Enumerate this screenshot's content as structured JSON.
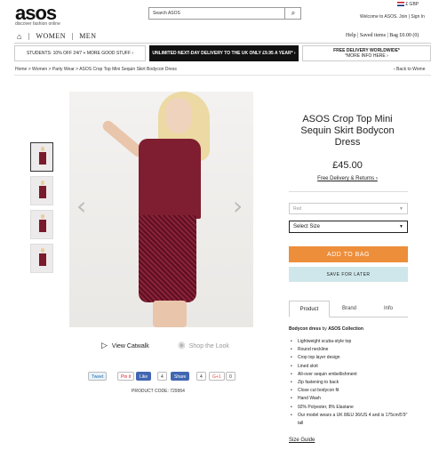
{
  "header": {
    "logo": "asos",
    "tagline": "discover fashion online",
    "search_placeholder": "Search ASOS",
    "currency": "£ GBP",
    "welcome": "Welcome to ASOS.  Join | Sign In",
    "nav": [
      "WOMEN",
      "MEN"
    ],
    "util_links": [
      "Help",
      "Saved items",
      "Bag £0.00 (0)"
    ]
  },
  "banners": {
    "students": "STUDENTS: 10% OFF 24/7 + MORE GOOD STUFF ›",
    "next_day": "UNLIMITED NEXT-DAY DELIVERY TO THE UK ONLY £9.95 A YEAR* ›",
    "free_delivery_title": "FREE DELIVERY WORLDWIDE*",
    "free_delivery_sub": "*MORE INFO HERE ›"
  },
  "breadcrumb": {
    "text": "Home  >  Women  >  Party Wear  >  ASOS Crop Top Mini Sequin Skirt Bodycon Dress",
    "back": "‹ Back to Wome"
  },
  "media": {
    "catwalk": "View Catwalk",
    "shop_look": "Shop the Look",
    "social": {
      "tweet": "Tweet",
      "pin": "Pin it",
      "like": "Like",
      "like_count": "4",
      "share": "Share",
      "share_count": "4",
      "gplus": "G+1",
      "gplus_count": "0"
    },
    "product_code": "PRODUCT CODE: 729954"
  },
  "product": {
    "title": "ASOS Crop Top Mini Sequin Skirt Bodycon Dress",
    "price": "£45.00",
    "delivery": "Free Delivery & Returns ›",
    "colour": "Red",
    "size": "Select Size",
    "add_to_bag": "ADD TO BAG",
    "save_later": "SAVE FOR LATER",
    "tabs": [
      "Product",
      "Brand",
      "Info"
    ],
    "desc_lead": "Bodycon dress",
    "desc_by": " by ",
    "desc_brand": "ASOS Collection",
    "bullets": [
      "Lightweight scuba-style top",
      "Round neckline",
      "Crop top layer design",
      "Lined skirt",
      "All-over sequin embellishment",
      "Zip fastening to back",
      "Close cut bodycon fit",
      "Hand Wash",
      "92% Polyester, 8% Elastane",
      "Our model wears a UK 8/EU 36/US 4 and is 175cm/5'9\" tall"
    ],
    "size_guide": "Size Guide"
  },
  "icons": {
    "search": "⌕",
    "home": "⌂",
    "prev": "‹",
    "next": "›",
    "play": "▷",
    "eye": "◉",
    "caret": "▼"
  },
  "colors": {
    "accent": "#ed8e3b",
    "save": "#cfe7ea",
    "dress": "#7e1e30"
  }
}
